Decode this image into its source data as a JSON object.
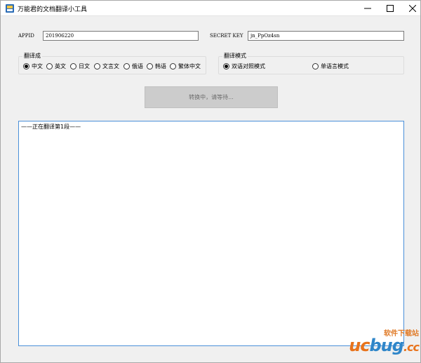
{
  "window": {
    "title": "万能君的文档翻译小工具",
    "controls": {
      "minimize": "—",
      "maximize": "☐",
      "close": "✕"
    }
  },
  "credentials": {
    "appid_label": "APPID",
    "appid_value": "201906220",
    "secret_label": "SECRET KEY",
    "secret_value": "jn_PpOz4sn"
  },
  "translate_to": {
    "title": "翻译成",
    "options": [
      {
        "label": "中文",
        "selected": true
      },
      {
        "label": "英文",
        "selected": false
      },
      {
        "label": "日文",
        "selected": false
      },
      {
        "label": "文言文",
        "selected": false
      },
      {
        "label": "俄语",
        "selected": false
      },
      {
        "label": "韩语",
        "selected": false
      },
      {
        "label": "繁体中文",
        "selected": false
      }
    ]
  },
  "mode": {
    "title": "翻译模式",
    "options": [
      {
        "label": "双语对照模式",
        "selected": true
      },
      {
        "label": "单语言模式",
        "selected": false
      }
    ]
  },
  "convert_button": {
    "label": "转换中，请等待..."
  },
  "output": {
    "text": "——正在翻译第1段——"
  },
  "watermark": {
    "top": "软件下载站",
    "uc": "uc",
    "bug": "bug",
    "cc": ".cc"
  },
  "colors": {
    "output_border": "#4a90d9",
    "button_bg": "#cccccc",
    "watermark_orange": "#e8731c",
    "watermark_blue": "#2f86c9"
  }
}
